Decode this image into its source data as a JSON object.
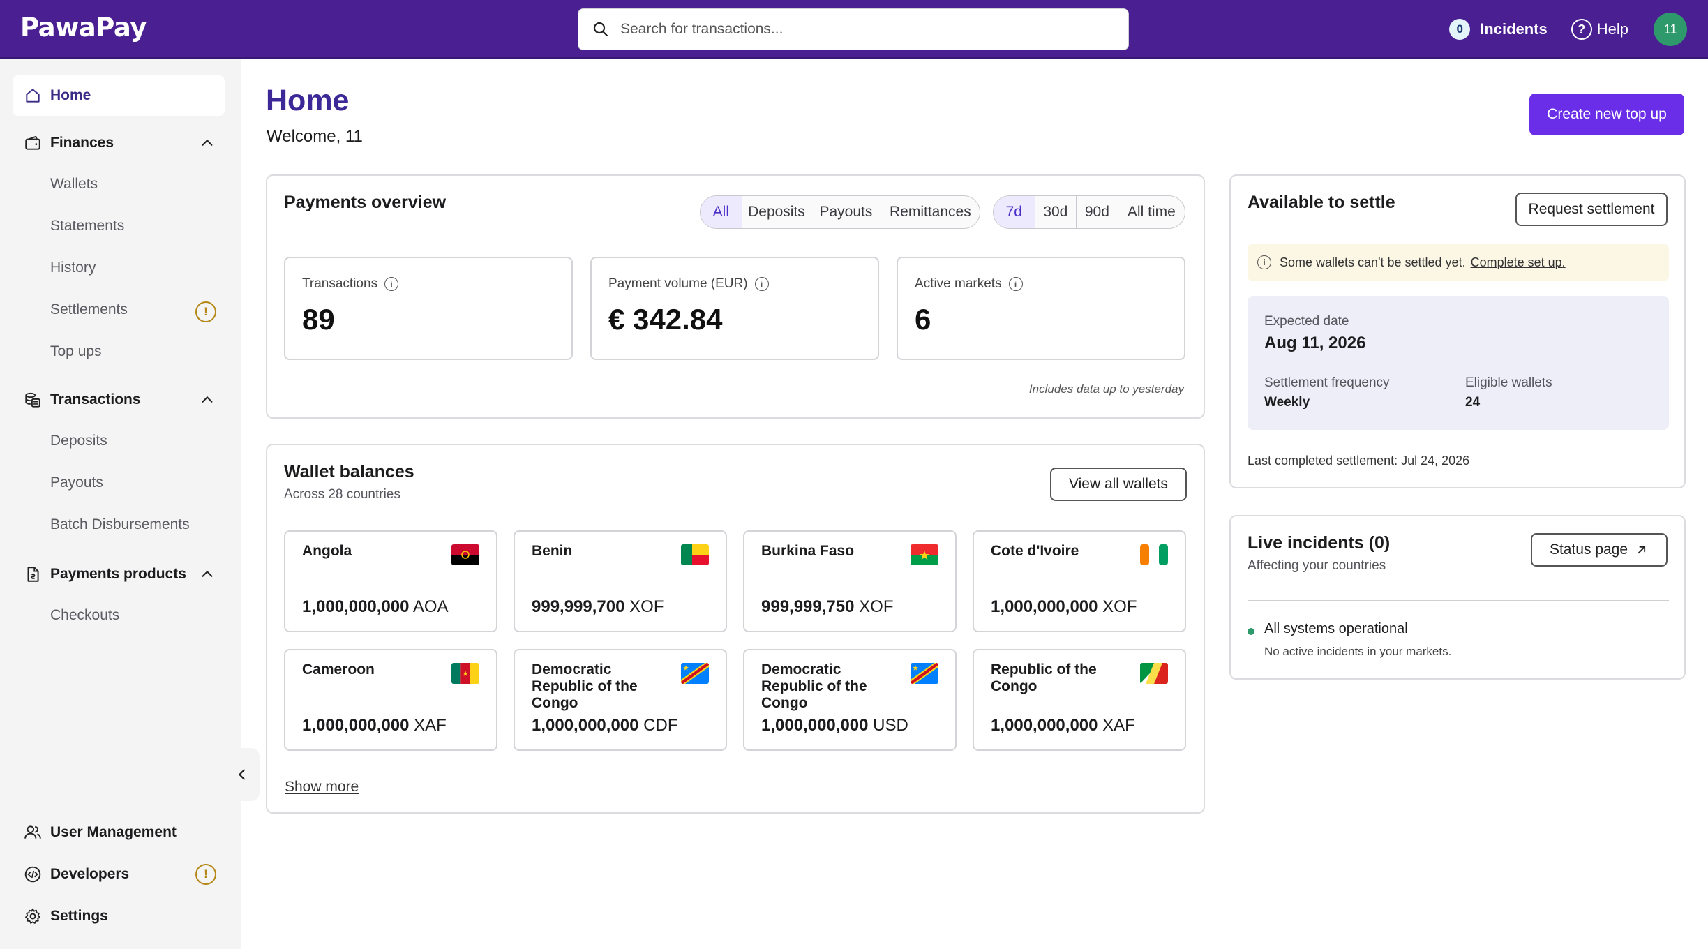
{
  "brand": {
    "logo": "PawaPay",
    "accent": "#4a1f92",
    "primary_button": "#6a2ee8"
  },
  "topbar": {
    "search_placeholder": "Search for transactions...",
    "incidents_count": "0",
    "incidents_label": "Incidents",
    "help_label": "Help",
    "avatar_initials": "11"
  },
  "sidebar": {
    "home": "Home",
    "finances": "Finances",
    "finances_items": [
      "Wallets",
      "Statements",
      "History",
      "Settlements",
      "Top ups"
    ],
    "transactions": "Transactions",
    "transactions_items": [
      "Deposits",
      "Payouts",
      "Batch Disbursements"
    ],
    "payments_products": "Payments products",
    "payments_products_items": [
      "Checkouts"
    ],
    "user_management": "User Management",
    "developers": "Developers",
    "settings": "Settings",
    "warn_glyph": "!"
  },
  "main": {
    "title": "Home",
    "welcome": "Welcome, 11",
    "create_button": "Create new top up"
  },
  "payments_overview": {
    "title": "Payments overview",
    "type_filters": [
      "All",
      "Deposits",
      "Payouts",
      "Remittances"
    ],
    "type_selected": "All",
    "period_filters": [
      "7d",
      "30d",
      "90d",
      "All time"
    ],
    "period_selected": "7d",
    "stats": [
      {
        "label": "Transactions",
        "value": "89"
      },
      {
        "label": "Payment volume (EUR)",
        "value": "€ 342.84"
      },
      {
        "label": "Active markets",
        "value": "6"
      }
    ],
    "footnote": "Includes data up to yesterday"
  },
  "wallet_balances": {
    "title": "Wallet balances",
    "subtitle": "Across 28 countries",
    "view_all": "View all wallets",
    "show_more": "Show more",
    "wallets": [
      {
        "country": "Angola",
        "amount": "1,000,000,000",
        "currency": "AOA"
      },
      {
        "country": "Benin",
        "amount": "999,999,700",
        "currency": "XOF"
      },
      {
        "country": "Burkina Faso",
        "amount": "999,999,750",
        "currency": "XOF"
      },
      {
        "country": "Cote d'Ivoire",
        "amount": "1,000,000,000",
        "currency": "XOF"
      },
      {
        "country": "Cameroon",
        "amount": "1,000,000,000",
        "currency": "XAF"
      },
      {
        "country": "Democratic Republic of the Congo",
        "amount": "1,000,000,000",
        "currency": "CDF"
      },
      {
        "country": "Democratic Republic of the Congo",
        "amount": "1,000,000,000",
        "currency": "USD"
      },
      {
        "country": "Republic of the Congo",
        "amount": "1,000,000,000",
        "currency": "XAF"
      }
    ]
  },
  "settle": {
    "title": "Available to settle",
    "request_button": "Request settlement",
    "notice_text": "Some wallets can't be settled yet.",
    "notice_link": "Complete set up.",
    "expected_date_label": "Expected date",
    "expected_date": "Aug 11, 2026",
    "frequency_label": "Settlement frequency",
    "frequency": "Weekly",
    "eligible_label": "Eligible wallets",
    "eligible": "24",
    "last_completed": "Last completed settlement:  Jul 24, 2026"
  },
  "incidents": {
    "title": "Live incidents (0)",
    "subtitle": "Affecting your countries",
    "status_button": "Status page",
    "status_text": "All systems operational",
    "status_sub": "No active incidents in your markets."
  }
}
